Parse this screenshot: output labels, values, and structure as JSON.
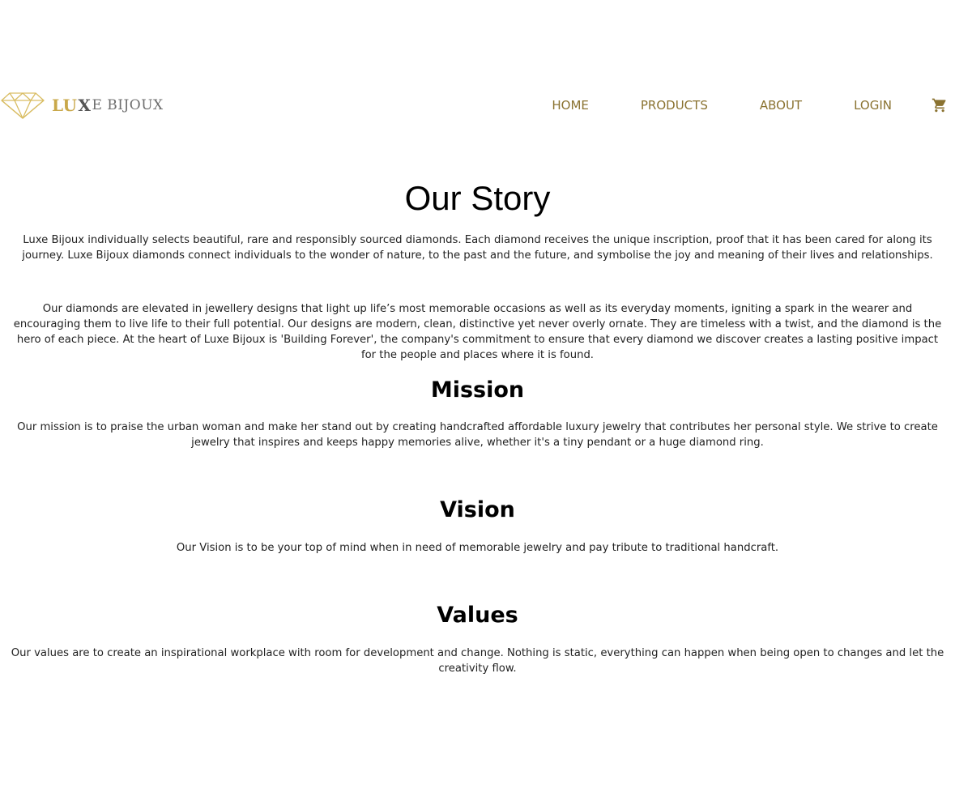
{
  "header": {
    "logo": {
      "part1": "LU",
      "part2": "X",
      "part3": "E BIJOUX"
    },
    "nav": [
      {
        "label": "HOME"
      },
      {
        "label": "PRODUCTS"
      },
      {
        "label": "ABOUT"
      },
      {
        "label": "LOGIN"
      }
    ],
    "cart_icon": "shopping-cart-icon"
  },
  "main": {
    "title": "Our Story",
    "story_p1": "Luxe Bijoux individually selects beautiful, rare and responsibly sourced diamonds. Each diamond receives the unique inscription, proof that it has been cared for along its journey. Luxe Bijoux diamonds connect individuals to the wonder of nature, to the past and the future, and symbolise the joy and meaning of their lives and relationships.",
    "story_p2": "Our diamonds are elevated in jewellery designs that light up life’s most memorable occasions as well as its everyday moments, igniting a spark in the wearer and encouraging them to live life to their full potential. Our designs are modern, clean, distinctive yet never overly ornate. They are timeless with a twist, and the diamond is the hero of each piece. At the heart of Luxe Bijoux is 'Building Forever', the company's commitment to ensure that every diamond we discover creates a lasting positive impact for the people and places where it is found.",
    "mission_title": "Mission",
    "mission_text": "Our mission is to praise the urban woman and make her stand out by creating handcrafted affordable luxury jewelry that contributes her personal style. We strive to create jewelry that inspires and keeps happy memories alive, whether it's a tiny pendant or a huge diamond ring.",
    "vision_title": "Vision",
    "vision_text": "Our Vision is to be your top of mind when in need of memorable jewelry and pay tribute to traditional handcraft.",
    "values_title": "Values",
    "values_text": "Our values are to create an inspirational workplace with room for development and change. Nothing is static, everything can happen when being open to changes and let the creativity flow."
  },
  "colors": {
    "gold": "#c9a84a",
    "nav": "#8a7230",
    "text": "#222222"
  }
}
